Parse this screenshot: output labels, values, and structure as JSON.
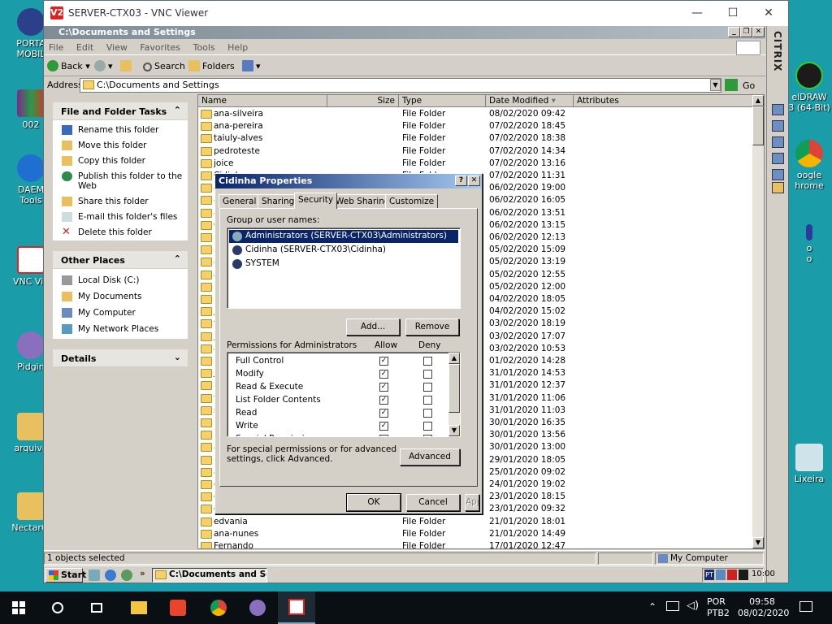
{
  "desktop_icons": [
    {
      "label": "PORTA",
      "label2": "MOBIL"
    },
    {
      "label": "002"
    },
    {
      "label": "DAEM",
      "label2": "Tools"
    },
    {
      "label": "VNC Vie"
    },
    {
      "label": "Pidgin"
    },
    {
      "label": "arquivo"
    },
    {
      "label": "NectarCl"
    },
    {
      "label": "elDRAW",
      "label2": "3 (64-Bit)"
    },
    {
      "label": "oogle",
      "label2": "hrome"
    },
    {
      "label": "o",
      "label2": "o"
    },
    {
      "label": "Lixeira"
    }
  ],
  "vnc": {
    "title": "SERVER-CTX03 - VNC Viewer",
    "logo": "V2",
    "minimize": "—",
    "maximize": "☐",
    "close": "✕"
  },
  "explorer": {
    "title": "C:\\Documents and Settings",
    "menu": [
      "File",
      "Edit",
      "View",
      "Favorites",
      "Tools",
      "Help"
    ],
    "toolbar": {
      "back": "Back",
      "search": "Search",
      "folders": "Folders"
    },
    "address_label": "Address",
    "address_value": "C:\\Documents and Settings",
    "go_label": "Go",
    "citrix_brand": "CITRIX",
    "file_tasks": {
      "title": "File and Folder Tasks",
      "items": [
        "Rename this folder",
        "Move this folder",
        "Copy this folder",
        "Publish this folder to the Web",
        "Share this folder",
        "E-mail this folder's files",
        "Delete this folder"
      ]
    },
    "other_places": {
      "title": "Other Places",
      "items": [
        "Local Disk (C:)",
        "My Documents",
        "My Computer",
        "My Network Places"
      ]
    },
    "details": {
      "title": "Details"
    },
    "columns": {
      "name": "Name",
      "size": "Size",
      "type": "Type",
      "date": "Date Modified",
      "attributes": "Attributes"
    },
    "files": [
      {
        "name": "ana-silveira",
        "type": "File Folder",
        "date": "08/02/2020 09:42"
      },
      {
        "name": "ana-pereira",
        "type": "File Folder",
        "date": "07/02/2020 18:45"
      },
      {
        "name": "taiuly-alves",
        "type": "File Folder",
        "date": "07/02/2020 18:38"
      },
      {
        "name": "pedroteste",
        "type": "File Folder",
        "date": "07/02/2020 14:34"
      },
      {
        "name": "joice",
        "type": "File Folder",
        "date": "07/02/2020 13:16"
      },
      {
        "name": "Cidinha",
        "type": "File Folder",
        "date": "07/02/2020 11:31"
      },
      {
        "name": "a",
        "type": "",
        "date": "06/02/2020 19:00"
      },
      {
        "name": "a",
        "type": "",
        "date": "06/02/2020 16:05"
      },
      {
        "name": "a",
        "type": "",
        "date": "06/02/2020 13:51"
      },
      {
        "name": "C",
        "type": "",
        "date": "06/02/2020 13:15"
      },
      {
        "name": "r",
        "type": "",
        "date": "06/02/2020 12:13"
      },
      {
        "name": "r",
        "type": "",
        "date": "05/02/2020 15:09"
      },
      {
        "name": "a",
        "type": "",
        "date": "05/02/2020 13:19"
      },
      {
        "name": "a",
        "type": "",
        "date": "05/02/2020 12:55"
      },
      {
        "name": "li",
        "type": "",
        "date": "05/02/2020 12:00"
      },
      {
        "name": "D",
        "type": "",
        "date": "04/02/2020 18:05"
      },
      {
        "name": "j",
        "type": "",
        "date": "04/02/2020 15:02"
      },
      {
        "name": "t",
        "type": "",
        "date": "03/02/2020 18:19"
      },
      {
        "name": "j",
        "type": "",
        "date": "03/02/2020 17:07"
      },
      {
        "name": "a",
        "type": "",
        "date": "03/02/2020 10:53"
      },
      {
        "name": "D",
        "type": "",
        "date": "01/02/2020 14:28"
      },
      {
        "name": "j",
        "type": "",
        "date": "31/01/2020 14:53"
      },
      {
        "name": "r",
        "type": "",
        "date": "31/01/2020 12:37"
      },
      {
        "name": "f",
        "type": "",
        "date": "31/01/2020 11:06"
      },
      {
        "name": "s",
        "type": "",
        "date": "31/01/2020 11:03"
      },
      {
        "name": "r",
        "type": "",
        "date": "30/01/2020 16:35"
      },
      {
        "name": "l",
        "type": "",
        "date": "30/01/2020 13:56"
      },
      {
        "name": "a",
        "type": "",
        "date": "30/01/2020 13:00"
      },
      {
        "name": "l",
        "type": "",
        "date": "29/01/2020 18:05"
      },
      {
        "name": "a",
        "type": "",
        "date": "25/01/2020 09:02"
      },
      {
        "name": "c",
        "type": "",
        "date": "24/01/2020 19:02"
      },
      {
        "name": "g",
        "type": "",
        "date": "23/01/2020 18:15"
      },
      {
        "name": "c",
        "type": "",
        "date": "23/01/2020 09:32"
      },
      {
        "name": "edvania",
        "type": "File Folder",
        "date": "21/01/2020 18:01"
      },
      {
        "name": "ana-nunes",
        "type": "File Folder",
        "date": "21/01/2020 14:49"
      },
      {
        "name": "Fernando",
        "type": "File Folder",
        "date": "17/01/2020 12:47"
      }
    ],
    "status_left": "1 objects selected",
    "status_right": "My Computer"
  },
  "remote_taskbar": {
    "start": "Start",
    "task": "C:\\Documents and Se...",
    "lang": "PT",
    "clock": "10:00"
  },
  "dialog": {
    "title": "Cidinha Properties",
    "help": "?",
    "close": "✕",
    "tabs": [
      "General",
      "Sharing",
      "Security",
      "Web Sharing",
      "Customize"
    ],
    "active_tab": "Security",
    "group_label": "Group or user names:",
    "users": [
      "Administrators (SERVER-CTX03\\Administrators)",
      "Cidinha (SERVER-CTX03\\Cidinha)",
      "SYSTEM"
    ],
    "add_button": "Add...",
    "remove_button": "Remove",
    "perm_label": "Permissions for Administrators",
    "allow_label": "Allow",
    "deny_label": "Deny",
    "permissions": [
      {
        "name": "Full Control",
        "allow": "✓",
        "deny": ""
      },
      {
        "name": "Modify",
        "allow": "✓",
        "deny": ""
      },
      {
        "name": "Read & Execute",
        "allow": "✓",
        "deny": ""
      },
      {
        "name": "List Folder Contents",
        "allow": "✓",
        "deny": ""
      },
      {
        "name": "Read",
        "allow": "✓",
        "deny": ""
      },
      {
        "name": "Write",
        "allow": "✓",
        "deny": ""
      },
      {
        "name": "Special Permissions",
        "allow": "",
        "deny": ""
      }
    ],
    "special_text": "For special permissions or for advanced settings, click Advanced.",
    "advanced_button": "Advanced",
    "ok_button": "OK",
    "cancel_button": "Cancel",
    "apply_button": "Apply"
  },
  "host_taskbar": {
    "lang_top": "POR",
    "lang_bottom": "PTB2",
    "time": "09:58",
    "date": "08/02/2020"
  }
}
